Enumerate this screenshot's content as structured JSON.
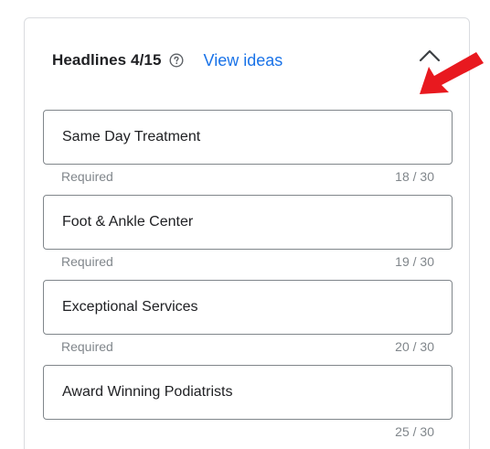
{
  "header": {
    "title": "Headlines 4/15",
    "view_ideas_label": "View ideas"
  },
  "headlines": [
    {
      "value": "Same Day Treatment",
      "helper": "Required",
      "count": "18 / 30"
    },
    {
      "value": "Foot & Ankle Center",
      "helper": "Required",
      "count": "19 / 30"
    },
    {
      "value": "Exceptional Services",
      "helper": "Required",
      "count": "20 / 30"
    },
    {
      "value": "Award Winning Podiatrists",
      "helper": "",
      "count": "25 / 30"
    }
  ],
  "icons": {
    "help": "help-circle-icon",
    "collapse": "chevron-up-icon",
    "annotation": "red-arrow-icon"
  },
  "colors": {
    "link": "#1a73e8",
    "annotation_arrow": "#e8191f",
    "border": "#80868b"
  }
}
